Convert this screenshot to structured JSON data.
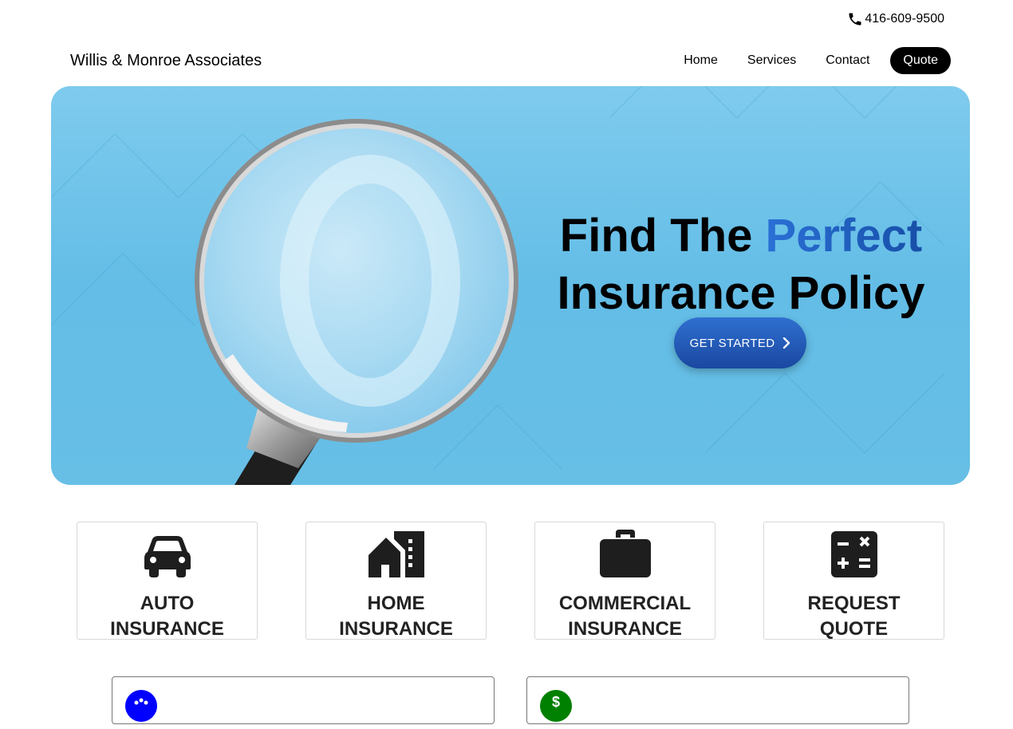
{
  "topbar": {
    "phone": "416-609-9500",
    "phone_icon": "phone-icon"
  },
  "header": {
    "brand": "Willis & Monroe Associates",
    "nav": {
      "home": "Home",
      "services": "Services",
      "contact": "Contact",
      "quote": "Quote"
    }
  },
  "hero": {
    "title_part1": "Find The ",
    "title_accent": "Perfect",
    "title_part2": "Insurance Policy",
    "cta_label": "GET STARTED",
    "cta_icon": "chevron-right-icon",
    "image": "magnifying-glass-photo",
    "colors": {
      "background": "#67bfe6",
      "accent": "#2a70d6",
      "cta": "#1f56b5"
    }
  },
  "services": [
    {
      "icon": "car-icon",
      "line1": "AUTO",
      "line2": "INSURANCE"
    },
    {
      "icon": "house-icon",
      "line1": "HOME",
      "line2": "INSURANCE"
    },
    {
      "icon": "briefcase-icon",
      "line1": "COMMERCIAL",
      "line2": "INSURANCE"
    },
    {
      "icon": "calculator-icon",
      "line1": "REQUEST",
      "line2": "QUOTE"
    }
  ],
  "lower_cards": [
    {
      "icon": "people-icon",
      "color": "#0000ff"
    },
    {
      "icon": "dollar-icon",
      "color": "#008000"
    }
  ]
}
